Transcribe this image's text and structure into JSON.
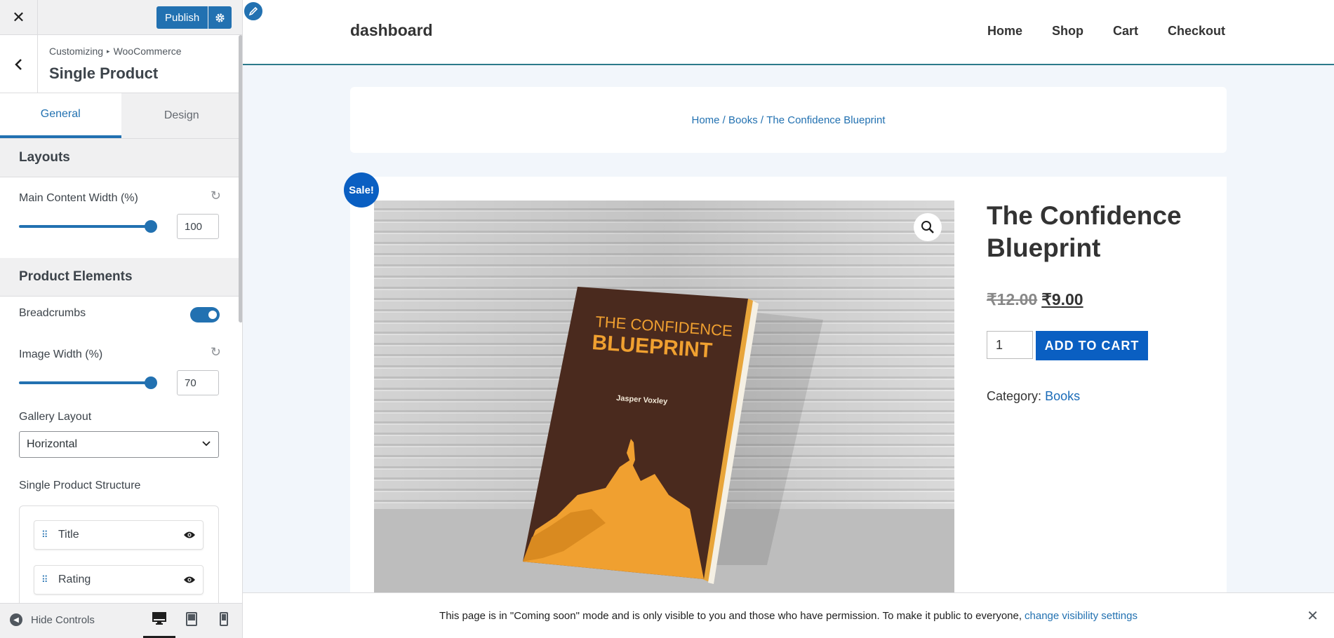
{
  "topbar": {
    "close_glyph": "✕",
    "publish_label": "Publish",
    "gear_icon": "gear-icon"
  },
  "section": {
    "breadcrumb_root": "Customizing",
    "breadcrumb_arrow": "▸",
    "breadcrumb_parent": "WooCommerce",
    "title": "Single Product"
  },
  "tabs": [
    {
      "label": "General"
    },
    {
      "label": "Design"
    }
  ],
  "layouts": {
    "heading": "Layouts",
    "main_content_width": {
      "label": "Main Content Width (%)",
      "value": "100"
    }
  },
  "product_elements": {
    "heading": "Product Elements",
    "breadcrumbs": {
      "label": "Breadcrumbs",
      "enabled": true
    },
    "image_width": {
      "label": "Image Width (%)",
      "value": "70"
    },
    "gallery_layout": {
      "label": "Gallery Layout",
      "selected": "Horizontal"
    },
    "structure": {
      "label": "Single Product Structure",
      "items": [
        {
          "label": "Title"
        },
        {
          "label": "Rating"
        }
      ]
    }
  },
  "footer": {
    "hide_controls": "Hide Controls"
  },
  "site": {
    "title": "dashboard",
    "nav": [
      {
        "label": "Home"
      },
      {
        "label": "Shop"
      },
      {
        "label": "Cart"
      },
      {
        "label": "Checkout"
      }
    ]
  },
  "breadcrumb": {
    "home": "Home",
    "sep": " / ",
    "cat": "Books",
    "current": "The Confidence Blueprint"
  },
  "product": {
    "sale_badge": "Sale!",
    "title": "The Confidence Blueprint",
    "price_old": "₹12.00",
    "price_new": "₹9.00",
    "quantity": "1",
    "add_to_cart": "ADD TO CART",
    "category_label": "Category:",
    "category": "Books",
    "book_cover": {
      "line1": "THE CONFIDENCE",
      "line2": "BLUEPRINT",
      "author": "Jasper Voxley"
    }
  },
  "notice": {
    "text": "This page is in \"Coming soon\" mode and is only visible to you and those who have permission. To make it public to everyone,",
    "link": "change visibility settings",
    "close_glyph": "✕"
  },
  "colors": {
    "accent": "#2271b1",
    "sale": "#0a5fc2",
    "book_brown": "#4a2a1e",
    "book_orange": "#f0a030"
  }
}
